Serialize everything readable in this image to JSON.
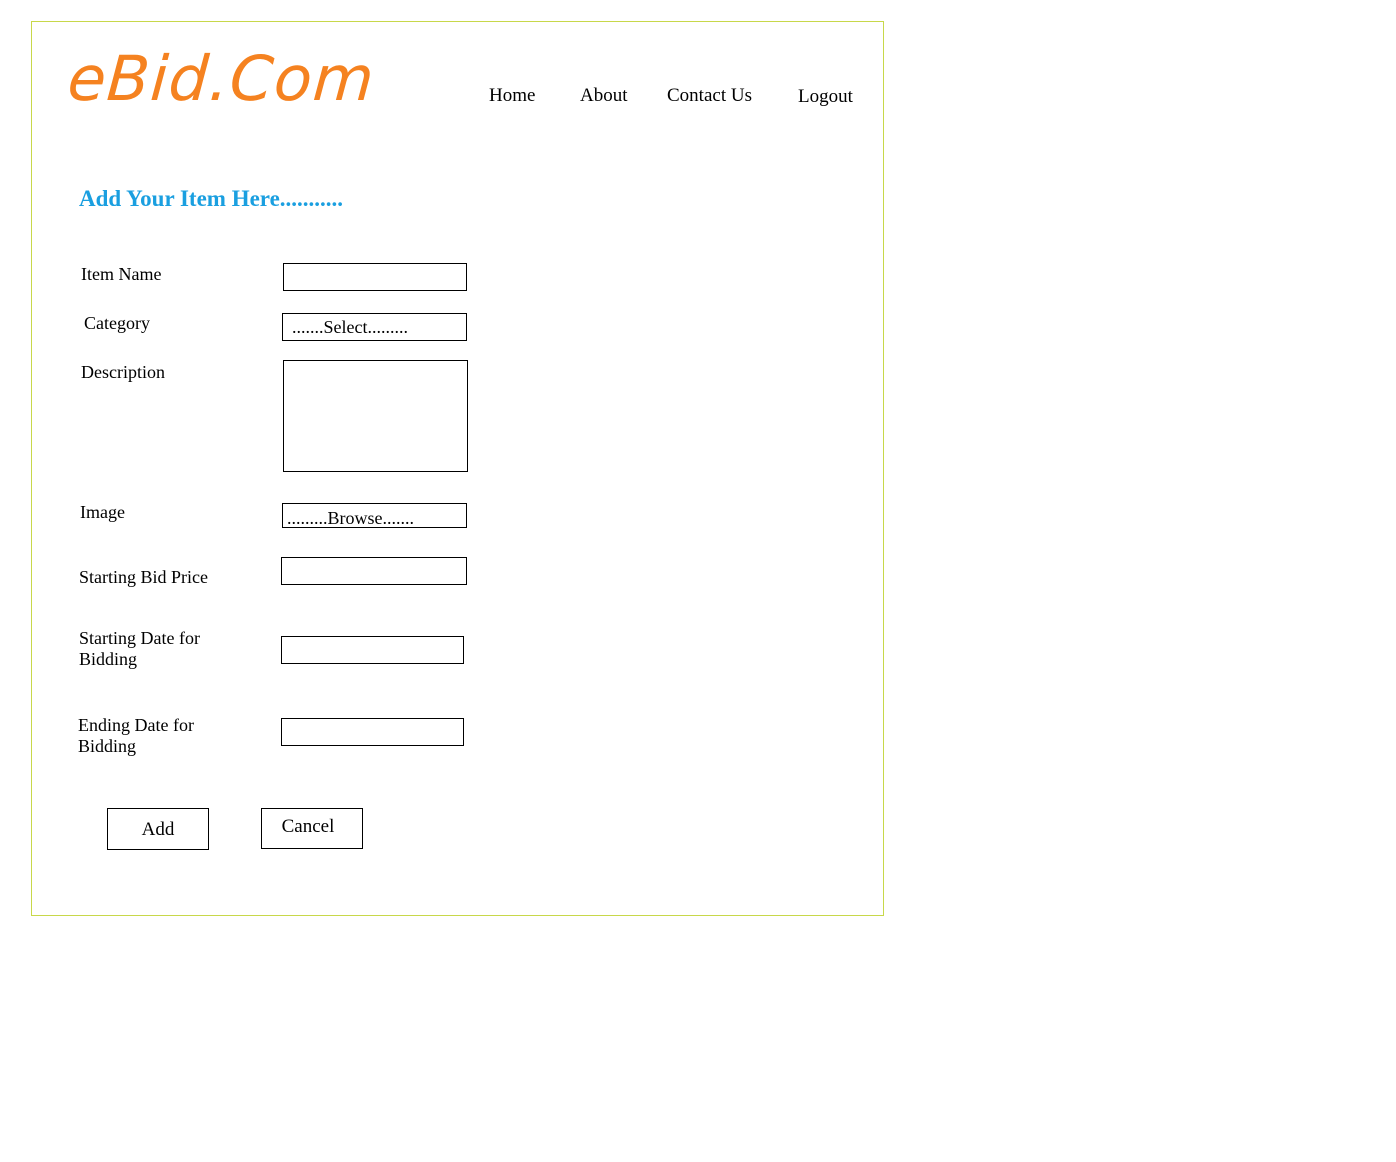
{
  "colors": {
    "logo": "#f58220",
    "heading": "#1a9fe0",
    "frame_border": "#c8d84a",
    "text": "#000000"
  },
  "header": {
    "logo": "eBid.Com",
    "nav": {
      "home": "Home",
      "about": "About",
      "contact": "Contact Us",
      "logout": "Logout"
    }
  },
  "form": {
    "title": "Add Your Item Here...........",
    "item_name_label": "Item Name",
    "item_name_value": "",
    "category_label": "Category",
    "category_selected": ".......Select.........",
    "description_label": "Description",
    "description_value": "",
    "image_label": "Image",
    "image_browse": ".........Browse.......",
    "starting_bid_label": "Starting Bid Price",
    "starting_bid_value": "",
    "start_date_label_line1": "Starting Date for",
    "start_date_label_line2": "Bidding",
    "start_date_value": "",
    "end_date_label_line1": "Ending Date for",
    "end_date_label_line2": "Bidding",
    "end_date_value": "",
    "add_button": "Add",
    "cancel_button": "Cancel"
  }
}
